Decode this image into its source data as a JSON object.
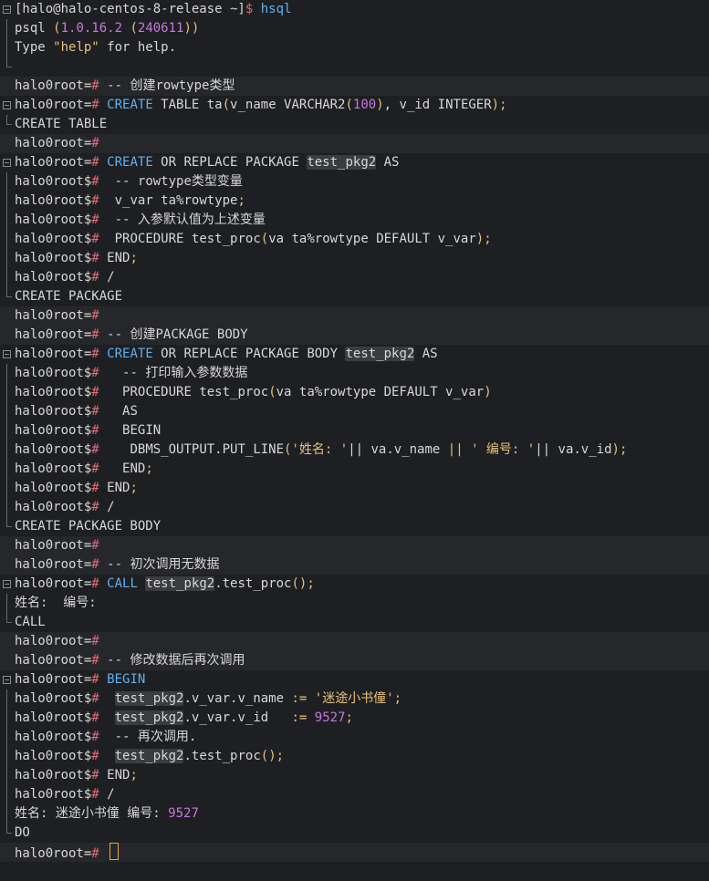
{
  "terminal": {
    "shell_prompt": "[halo@halo-centos-8-release ~]",
    "shell_symbol": "$",
    "command": "hsql",
    "version_line": "psql (1.0.16.2 (240611))",
    "help_line": "Type \"help\" for help.",
    "prompt_main": "halo0root=",
    "prompt_cont": "halo0root$",
    "hash": "#",
    "lines": [
      "-- 创建rowtype类型",
      "CREATE TABLE ta(v_name VARCHAR2(100), v_id INTEGER);",
      "CREATE TABLE",
      "CREATE OR REPLACE PACKAGE test_pkg2 AS",
      "-- rowtype类型变量",
      "v_var ta%rowtype;",
      "-- 入参默认值为上述变量",
      "PROCEDURE test_proc(va ta%rowtype DEFAULT v_var);",
      "END;",
      "/",
      "CREATE PACKAGE",
      "-- 创建PACKAGE BODY",
      "CREATE OR REPLACE PACKAGE BODY test_pkg2 AS",
      "-- 打印输入参数数据",
      "PROCEDURE test_proc(va ta%rowtype DEFAULT v_var)",
      "AS",
      "BEGIN",
      "DBMS_OUTPUT.PUT_LINE('姓名: '|| va.v_name || ' 编号: '|| va.v_id);",
      "END;",
      "END;",
      "/",
      "CREATE PACKAGE BODY",
      "-- 初次调用无数据",
      "CALL test_pkg2.test_proc();",
      "姓名:  编号:",
      "CALL",
      "-- 修改数据后再次调用",
      "BEGIN",
      "test_pkg2.v_var.v_name := '迷途小书僮';",
      "test_pkg2.v_var.v_id   := 9527;",
      "-- 再次调用.",
      "test_pkg2.test_proc();",
      "END;",
      "/",
      "姓名: 迷途小书僮 编号: 9527",
      "DO"
    ]
  }
}
